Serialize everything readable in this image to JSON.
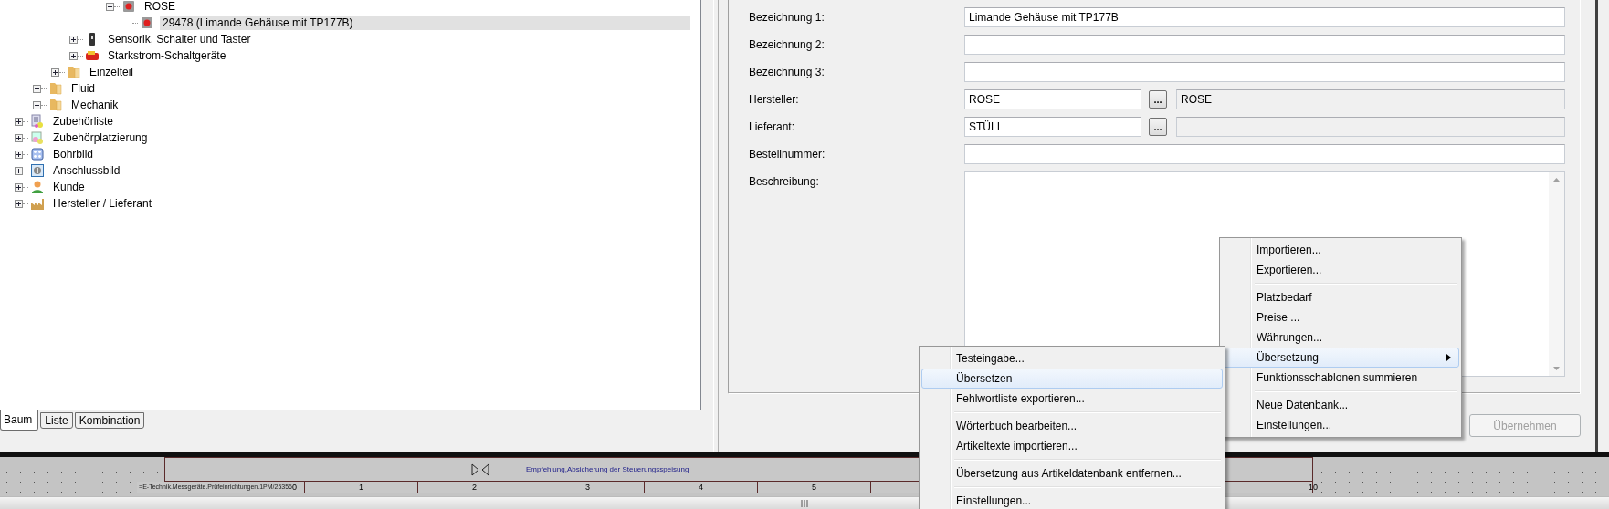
{
  "tree": {
    "items": [
      {
        "children": [
          {
            "children": [
              {
                "children": [
                  {
                    "children": [
                      {
                        "children": [
                          {
                            "label": "ROSE",
                            "kind": "vendor",
                            "expanded": true,
                            "selected": false,
                            "children": [
                              {
                                "label": "29478 (Limande Gehäuse mit TP177B)",
                                "kind": "part",
                                "selected": true
                              }
                            ]
                          }
                        ]
                      }
                    ]
                  },
                  {
                    "label": "Sensorik, Schalter und Taster",
                    "kind": "sensor",
                    "expanded": false,
                    "selected": false
                  },
                  {
                    "label": "Starkstrom-Schaltgeräte",
                    "kind": "contactor",
                    "expanded": false,
                    "selected": false
                  }
                ]
              },
              {
                "label": "Einzelteil",
                "kind": "folder",
                "expanded": false,
                "selected": false
              }
            ]
          },
          {
            "label": "Fluid",
            "kind": "folder",
            "expanded": false,
            "selected": false
          },
          {
            "label": "Mechanik",
            "kind": "folder",
            "expanded": false,
            "selected": false
          }
        ]
      },
      {
        "label": "Zubehörliste",
        "kind": "list",
        "expanded": false,
        "selected": false
      },
      {
        "label": "Zubehörplatzierung",
        "kind": "placement",
        "expanded": false,
        "selected": false
      },
      {
        "label": "Bohrbild",
        "kind": "drill",
        "expanded": false,
        "selected": false
      },
      {
        "label": "Anschlussbild",
        "kind": "connection",
        "expanded": false,
        "selected": false
      },
      {
        "label": "Kunde",
        "kind": "customer",
        "expanded": false,
        "selected": false
      },
      {
        "label": "Hersteller / Lieferant",
        "kind": "factory",
        "expanded": false,
        "selected": false
      }
    ]
  },
  "tabs": [
    {
      "label": "Baum",
      "selected": true
    },
    {
      "label": "Liste",
      "selected": false
    },
    {
      "label": "Kombination",
      "selected": false
    }
  ],
  "form": {
    "fields": [
      {
        "label": "Bezeichnung 1:",
        "kind": "text",
        "value": "Limande Gehäuse mit TP177B"
      },
      {
        "label": "Bezeichnung 2:",
        "kind": "text"
      },
      {
        "label": "Bezeichnung 3:",
        "kind": "text"
      },
      {
        "label": "Hersteller:",
        "kind": "lookup",
        "value": "ROSE",
        "button": "...",
        "display": "ROSE"
      },
      {
        "label": "Lieferant:",
        "kind": "lookup",
        "value": "STÜLI",
        "button": "..."
      },
      {
        "label": "Bestellnummer:",
        "kind": "text"
      },
      {
        "label": "Beschreibung:",
        "kind": "multiline"
      }
    ],
    "apply_button": {
      "label": "Übernehmen",
      "disabled": true
    }
  },
  "context_menu": {
    "groups": [
      [
        {
          "label": "Importieren...",
          "selected": false,
          "has_submenu": false
        },
        {
          "label": "Exportieren...",
          "selected": false,
          "has_submenu": false
        }
      ],
      [
        {
          "label": "Platzbedarf",
          "selected": false,
          "has_submenu": false
        },
        {
          "label": "Preise ...",
          "selected": false,
          "has_submenu": false
        },
        {
          "label": "Währungen...",
          "selected": false,
          "has_submenu": false
        },
        {
          "label": "Übersetzung",
          "selected": true,
          "has_submenu": true
        },
        {
          "label": "Funktionsschablonen summieren",
          "selected": false,
          "has_submenu": false
        }
      ],
      [
        {
          "label": "Neue Datenbank...",
          "selected": false,
          "has_submenu": false
        },
        {
          "label": "Einstellungen...",
          "selected": false,
          "has_submenu": false
        }
      ]
    ]
  },
  "submenu": {
    "groups": [
      [
        {
          "label": "Testeingabe...",
          "selected": false
        },
        {
          "label": "Übersetzen",
          "selected": true
        },
        {
          "label": "Fehlwortliste exportieren...",
          "selected": false
        }
      ],
      [
        {
          "label": "Wörterbuch bearbeiten...",
          "selected": false
        },
        {
          "label": "Artikeltexte importieren...",
          "selected": false
        }
      ],
      [
        {
          "label": "Übersetzung aus Artikeldatenbank entfernen...",
          "selected": false
        }
      ],
      [
        {
          "label": "Einstellungen...",
          "selected": false
        }
      ]
    ]
  },
  "drawing": {
    "heading": "Empfehlung,Absicherung der Steuerungsspeisung",
    "path": "=E-Technik.Messgeräte.Prüfeinrichtungen.1PM/25356",
    "start_column": "0",
    "columns": [
      "1",
      "2",
      "3",
      "4",
      "5"
    ],
    "end_column": "10"
  }
}
